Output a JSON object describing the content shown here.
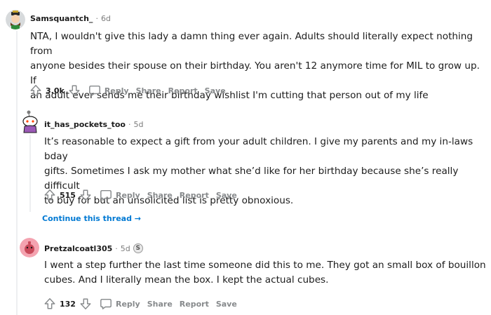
{
  "comments": [
    {
      "username": "Samsquantch_",
      "time": "6d",
      "body_lines": [
        "NTA, I wouldn't give this lady a damn thing ever again. Adults should literally expect nothing from",
        "anyone besides their spouse on their birthday. You aren't 12 anymore time for MIL to grow up. If",
        "an adult ever sends me their birthday wishlist I'm cutting that person out of my life"
      ],
      "score": "3.0k",
      "reply_label": "Reply",
      "share_label": "Share",
      "report_label": "Report",
      "save_label": "Save"
    },
    {
      "username": "it_has_pockets_too",
      "time": "5d",
      "body_lines": [
        "It’s reasonable to expect a gift from your adult children. I give my parents and my in-laws bday",
        "gifts. Sometimes I ask my mother what she’d like for her birthday because she’s really difficult",
        "to buy for but an unsolicited list is pretty obnoxious."
      ],
      "score": "515",
      "reply_label": "Reply",
      "share_label": "Share",
      "report_label": "Report",
      "save_label": "Save"
    },
    {
      "username": "Pretzalcoatl305",
      "time": "5d",
      "award": "S",
      "body_lines": [
        "I went a step further the last time someone did this to me. They got an small box of bouillon",
        "cubes. And I literally mean the box. I kept the actual cubes."
      ],
      "score": "132",
      "reply_label": "Reply",
      "share_label": "Share",
      "report_label": "Report",
      "save_label": "Save"
    }
  ],
  "continue_thread": "Continue this thread",
  "colors": {
    "meta_gray": "#7c7c7c",
    "action_gray": "#878a8c",
    "link_blue": "#0079d3",
    "thread_line": "#edeff1"
  }
}
